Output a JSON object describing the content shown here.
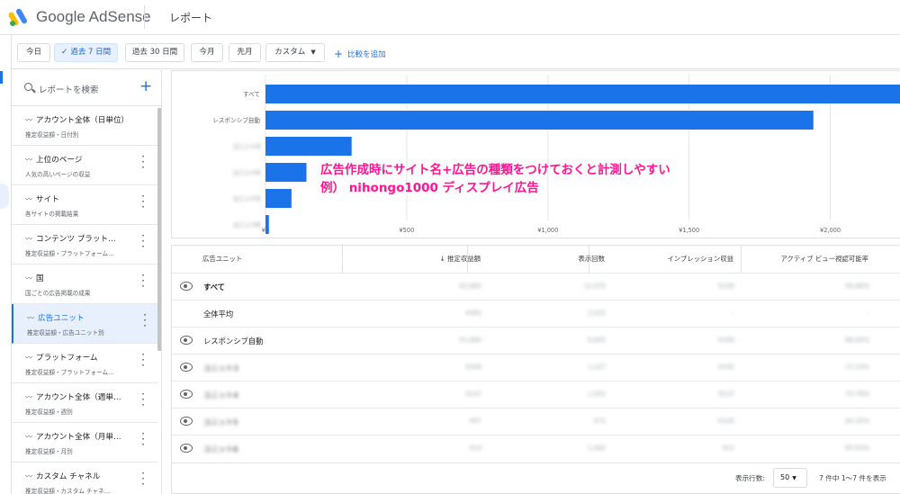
{
  "header": {
    "brand": "Google AdSense",
    "page_title": "レポート"
  },
  "filters": {
    "chips": [
      "今日",
      "過去 7 日間",
      "過去 30 日間",
      "今月",
      "先月",
      "カスタム"
    ],
    "selected": "過去 7 日間",
    "add_compare": "比較を追加"
  },
  "sidebar": {
    "search_placeholder": "レポートを検索",
    "items": [
      {
        "title": "アカウント全体（日単位）",
        "sub": "推定収益額・日付別"
      },
      {
        "title": "上位のページ",
        "sub": "人気の高いページの収益"
      },
      {
        "title": "サイト",
        "sub": "各サイトの掲載結果"
      },
      {
        "title": "コンテンツ プラット…",
        "sub": "推定収益額・プラットフォーム…"
      },
      {
        "title": "国",
        "sub": "国ごとの広告掲載の成果"
      },
      {
        "title": "広告ユニット",
        "sub": "推定収益額・広告ユニット別"
      },
      {
        "title": "プラットフォーム",
        "sub": "推定収益額・プラットフォーム…"
      },
      {
        "title": "アカウント全体（週単…",
        "sub": "推定収益額・週別"
      },
      {
        "title": "アカウント全体（月単…",
        "sub": "推定収益額・月別"
      },
      {
        "title": "カスタム チャネル",
        "sub": "推定収益額・カスタム チャネ…"
      }
    ],
    "active_index": 5
  },
  "chart_data": {
    "type": "bar",
    "orientation": "horizontal",
    "categories": [
      "すべて",
      "レスポンシブ自動",
      "ユニット3",
      "ユニット4",
      "ユニット5",
      "ユニット6"
    ],
    "values": [
      2250,
      1940,
      305,
      145,
      92,
      12
    ],
    "x_ticks": [
      "¥0",
      "¥500",
      "¥1,000",
      "¥1,500",
      "¥2,000"
    ],
    "xlim": [
      0,
      2250
    ],
    "grid": true,
    "bar_color": "#1a73e8"
  },
  "annotation": {
    "line1": "広告作成時にサイト名+広告の種類をつけておくと計測しやすい",
    "line2": "例） nihongo1000 ディスプレイ広告",
    "color": "#ff1493"
  },
  "table": {
    "headers": [
      "広告ユニット",
      "↓ 推定収益額",
      "表示回数",
      "インプレッション収益",
      "アクティブ ビュー視認可能率"
    ],
    "rows": [
      {
        "name": "すべて",
        "eye": true,
        "bold": true,
        "cells": [
          "¥2,680",
          "12,870",
          "¥199",
          "69.88%"
        ]
      },
      {
        "name": "全体平均",
        "eye": false,
        "bold": false,
        "cells": [
          "¥383",
          "2,015",
          "–",
          "–"
        ]
      },
      {
        "name": "レスポンシブ自動",
        "eye": true,
        "bold": false,
        "cells": [
          "¥1,880",
          "9,845",
          "¥189",
          "68.90%"
        ]
      },
      {
        "name": "ユニット3",
        "eye": true,
        "bold": false,
        "cells": [
          "¥308",
          "1,227",
          "¥245",
          "72.10%"
        ]
      },
      {
        "name": "ユニット4",
        "eye": true,
        "bold": false,
        "cells": [
          "¥147",
          "1,052",
          "¥137",
          "70.78%"
        ]
      },
      {
        "name": "ユニット5",
        "eye": true,
        "bold": false,
        "cells": [
          "¥97",
          "972",
          "¥100",
          "64.30%"
        ]
      },
      {
        "name": "ユニット6",
        "eye": true,
        "bold": false,
        "cells": [
          "¥13",
          "1,082",
          "¥12",
          "65.83%"
        ]
      }
    ],
    "rows_per_page_label": "表示行数:",
    "rows_per_page": "50",
    "range": "7 件中 1〜7 件を表示"
  }
}
